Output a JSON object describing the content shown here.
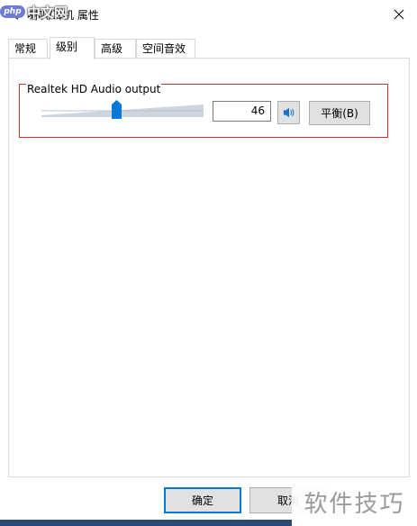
{
  "window": {
    "title": "喇叭/耳机 属性"
  },
  "watermark_top": {
    "badge": "php",
    "text": "中文网"
  },
  "tabs": [
    {
      "label": "常规",
      "active": false
    },
    {
      "label": "级别",
      "active": true
    },
    {
      "label": "高级",
      "active": false
    },
    {
      "label": "空间音效",
      "active": false
    }
  ],
  "level": {
    "group_label": "Realtek HD Audio output",
    "volume_value": "46",
    "volume_fraction": 0.46,
    "balance_label": "平衡(B)",
    "speaker_icon": "speaker-icon"
  },
  "footer": {
    "ok_label": "确定",
    "cancel_label": "取消"
  },
  "watermark_bottom": {
    "text": "软件技巧"
  },
  "colors": {
    "highlight": "#cc3333",
    "thumb": "#0078d7",
    "track": "#cdd5df",
    "focus_border": "#0078d7"
  }
}
